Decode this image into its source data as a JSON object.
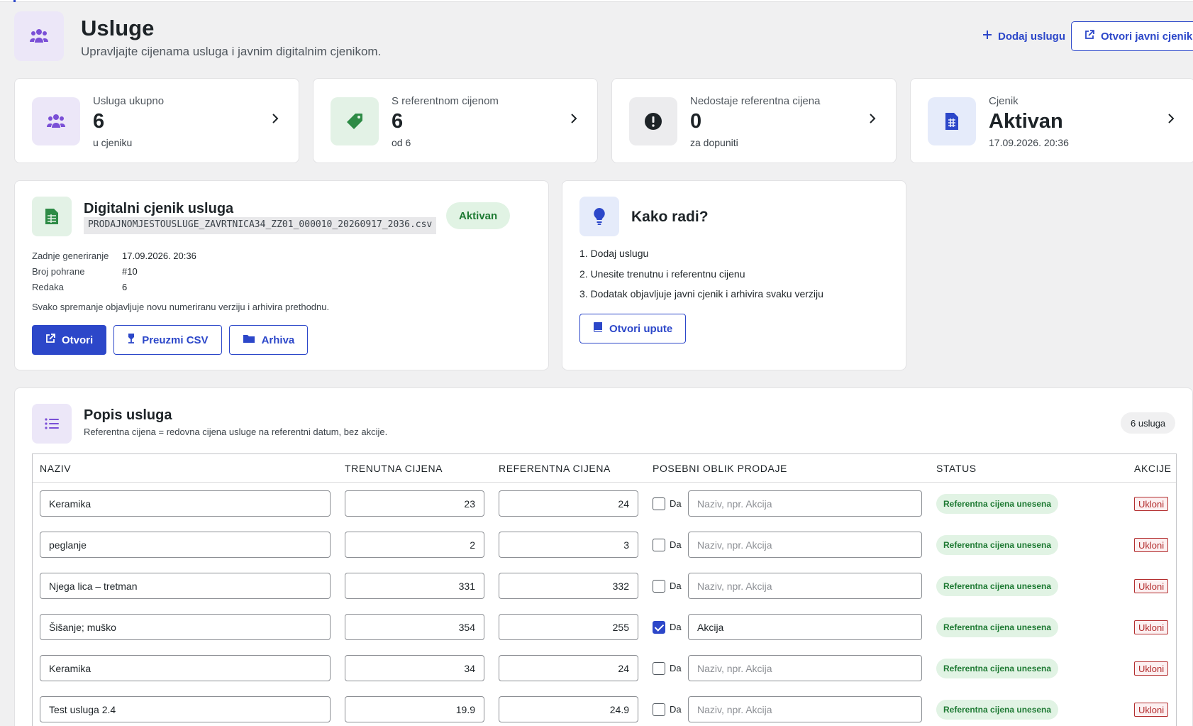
{
  "colors": {
    "accent": "#2c47c9",
    "success_bg": "#e1f3e4",
    "success_text": "#1e7a33",
    "danger": "#b32d2e"
  },
  "header": {
    "title": "Usluge",
    "subtitle": "Upravljajte cijenama usluga i javnim digitalnim cjenikom.",
    "add_label": "Dodaj uslugu",
    "public_label": "Otvori javni cjenik",
    "icon": "users-icon"
  },
  "stats": [
    {
      "label": "Usluga ukupno",
      "value": "6",
      "note": "u cjeniku",
      "icon": "users-icon"
    },
    {
      "label": "S referentnom cijenom",
      "value": "6",
      "note": "od 6",
      "icon": "tag-icon"
    },
    {
      "label": "Nedostaje referentna cijena",
      "value": "0",
      "note": "za dopuniti",
      "icon": "warning-icon"
    },
    {
      "label": "Cjenik",
      "value": "Aktivan",
      "note": "17.09.2026. 20:36",
      "icon": "document-icon"
    }
  ],
  "pricelist": {
    "title": "Digitalni cjenik usluga",
    "filename": "PRODAJNOMJESTOUSLUGE_ZAVRTNICA34_ZZ01_000010_20260917_2036.csv",
    "status": "Aktivan",
    "meta": [
      {
        "key": "Zadnje generiranje",
        "value": "17.09.2026. 20:36"
      },
      {
        "key": "Broj pohrane",
        "value": "#10"
      },
      {
        "key": "Redaka",
        "value": "6"
      }
    ],
    "note": "Svako spremanje objavljuje novu numeriranu verziju i arhivira prethodnu.",
    "btn_open": "Otvori",
    "btn_csv": "Preuzmi CSV",
    "btn_archive": "Arhiva"
  },
  "how": {
    "title": "Kako radi?",
    "steps": [
      "1. Dodaj uslugu",
      "2. Unesite trenutnu i referentnu cijenu",
      "3. Dodatak objavljuje javni cjenik i arhivira svaku verziju"
    ],
    "btn": "Otvori upute"
  },
  "services": {
    "title": "Popis usluga",
    "subtitle": "Referentna cijena = redovna cijena usluge na referentni datum, bez akcije.",
    "count": "6 usluga",
    "columns": [
      "NAZIV",
      "TRENUTNA CIJENA",
      "REFERENTNA CIJENA",
      "POSEBNI OBLIK PRODAJE",
      "STATUS",
      "AKCIJE"
    ],
    "special_label": "Da",
    "special_placeholder": "Naziv, npr. Akcija",
    "status_label": "Referentna cijena unesena",
    "remove_label": "Ukloni",
    "rows": [
      {
        "name": "Keramika",
        "current": "23",
        "reference": "24",
        "special": false,
        "special_name": ""
      },
      {
        "name": "peglanje",
        "current": "2",
        "reference": "3",
        "special": false,
        "special_name": ""
      },
      {
        "name": "Njega lica – tretman",
        "current": "331",
        "reference": "332",
        "special": false,
        "special_name": ""
      },
      {
        "name": "Šišanje; muško",
        "current": "354",
        "reference": "255",
        "special": true,
        "special_name": "Akcija"
      },
      {
        "name": "Keramika",
        "current": "34",
        "reference": "24",
        "special": false,
        "special_name": ""
      },
      {
        "name": "Test usluga 2.4",
        "current": "19.9",
        "reference": "24.9",
        "special": false,
        "special_name": ""
      }
    ]
  }
}
